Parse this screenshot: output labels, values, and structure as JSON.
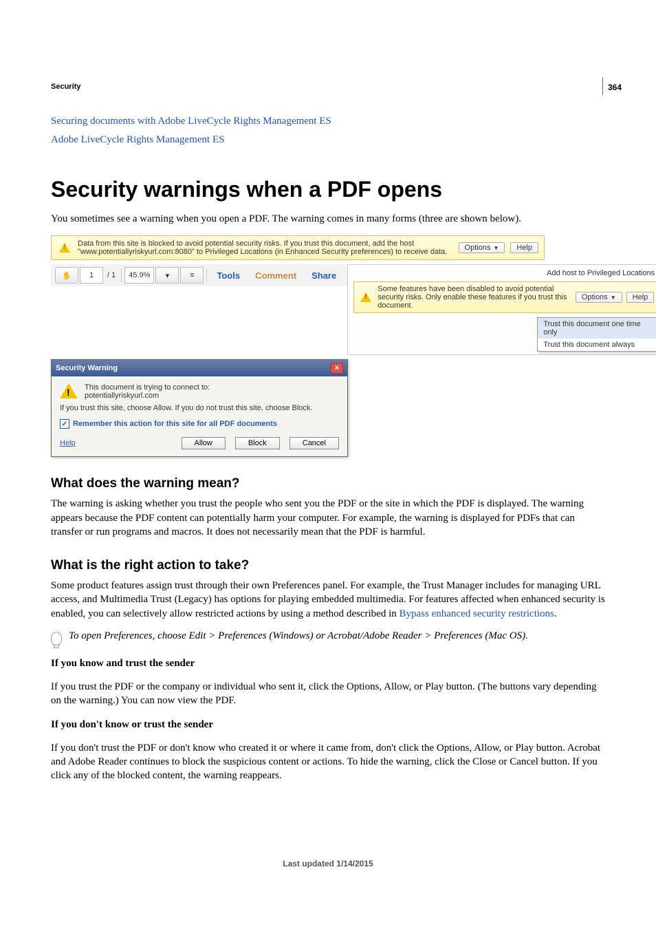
{
  "page_number": "364",
  "running_head": "Security",
  "links": {
    "l1": "Securing documents with Adobe LiveCycle Rights Management ES",
    "l2": "Adobe LiveCycle Rights Management ES"
  },
  "h1": "Security warnings when a PDF opens",
  "intro": "You sometimes see a warning when you open a PDF. The warning comes in many forms (three are shown below).",
  "mock": {
    "bar1_text": "Data from this site is blocked to avoid potential security risks. If you trust this document, add the host \"www.potentiallyriskyurl.com:8080\" to Privileged Locations (in Enhanced Security preferences) to receive data.",
    "options": "Options",
    "help": "Help",
    "page_cur": "1",
    "page_total": "/  1",
    "zoom": "45.9%",
    "tools": "Tools",
    "comment": "Comment",
    "share": "Share",
    "addhost": "Add host to Privileged Locations",
    "bar2_text": "Some features have been disabled to avoid potential security risks. Only enable these features if you trust this document.",
    "trust_once": "Trust this document one time only",
    "trust_always": "Trust this document always",
    "dlg_title": "Security Warning",
    "dlg_line1": "This document is trying to connect to:",
    "dlg_host": "potentiallyriskyurl.com",
    "dlg_line2": "If you trust this site, choose Allow. If you do not trust this site, choose Block.",
    "dlg_check": "Remember this action for this site for all PDF documents",
    "dlg_help": "Help",
    "dlg_allow": "Allow",
    "dlg_block": "Block",
    "dlg_cancel": "Cancel"
  },
  "sec1": {
    "h": "What does the warning mean?",
    "p": "The warning is asking whether you trust the people who sent you the PDF or the site in which the PDF is displayed. The warning appears because the PDF content can potentially harm your computer. For example, the warning is displayed for PDFs that can transfer or run programs and macros. It does not necessarily mean that the PDF is harmful."
  },
  "sec2": {
    "h": "What is the right action to take?",
    "p1": "Some product features assign trust through their own Preferences panel. For example, the Trust Manager includes for managing URL access, and Multimedia Trust (Legacy) has options for playing embedded multimedia. For features affected when enhanced security is enabled, you can selectively allow restricted actions by using a method described in ",
    "p1_link": "Bypass enhanced security restrictions",
    "tip": "To open Preferences, choose Edit > Preferences (Windows) or Acrobat/Adobe Reader > Preferences (Mac OS).",
    "h3a": "If you know and trust the sender",
    "p2": "If you trust the PDF or the company or individual who sent it, click the Options, Allow, or Play button. (The buttons vary depending on the warning.) You can now view the PDF.",
    "h3b": "If you don't know or trust the sender",
    "p3": "If you don't trust the PDF or don't know who created it or where it came from, don't click the Options, Allow, or Play button. Acrobat and Adobe Reader continues to block the suspicious content or actions. To hide the warning, click the Close or Cancel button. If you click any of the blocked content, the warning reappears."
  },
  "footer": "Last updated 1/14/2015"
}
